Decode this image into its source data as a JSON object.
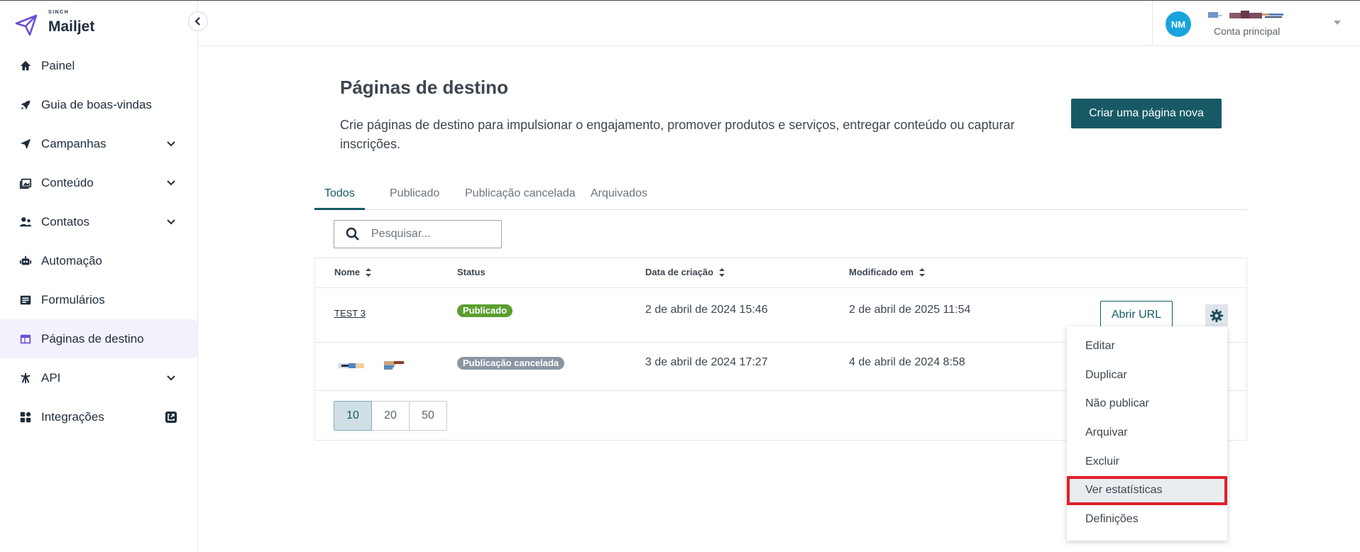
{
  "brand": {
    "sinch": "SINCH",
    "name": "Mailjet"
  },
  "sidebar": {
    "collapse_icon": "chevron-left-icon",
    "items": [
      {
        "label": "Painel",
        "icon": "home-icon"
      },
      {
        "label": "Guia de boas-vindas",
        "icon": "rocket-icon"
      },
      {
        "label": "Campanhas",
        "icon": "paper-plane-icon",
        "expandable": true
      },
      {
        "label": "Conteúdo",
        "icon": "image-gallery-icon",
        "expandable": true
      },
      {
        "label": "Contatos",
        "icon": "users-icon",
        "expandable": true
      },
      {
        "label": "Automação",
        "icon": "robot-icon"
      },
      {
        "label": "Formulários",
        "icon": "form-icon"
      },
      {
        "label": "Páginas de destino",
        "icon": "layout-icon",
        "active": true
      },
      {
        "label": "API",
        "icon": "api-icon",
        "expandable": true
      },
      {
        "label": "Integrações",
        "icon": "grid-icon",
        "external": true
      }
    ]
  },
  "header": {
    "avatar_initials": "NM",
    "account_type": "Conta principal"
  },
  "page": {
    "title": "Páginas de destino",
    "description": "Crie páginas de destino para impulsionar o engajamento, promover produtos e serviços, entregar conteúdo ou capturar inscrições.",
    "create_button": "Criar uma página nova"
  },
  "tabs": [
    {
      "label": "Todos",
      "active": true
    },
    {
      "label": "Publicado"
    },
    {
      "label": "Publicação cancelada"
    },
    {
      "label": "Arquivados"
    }
  ],
  "search": {
    "placeholder": "Pesquisar..."
  },
  "table": {
    "headers": {
      "name": "Nome",
      "status": "Status",
      "created": "Data de criação",
      "modified": "Modificado em"
    },
    "rows": [
      {
        "name": "TEST 3",
        "status": "Publicado",
        "created": "2 de abril de 2024 15:46",
        "modified": "2 de abril de 2025 11:54",
        "action": "Abrir URL"
      },
      {
        "name": "",
        "status": "Publicação cancelada",
        "created": "3 de abril de 2024 17:27",
        "modified": "4 de abril de 2024 8:58"
      }
    ]
  },
  "pagination": {
    "sizes": [
      "10",
      "20",
      "50"
    ],
    "selected": "10"
  },
  "menu": {
    "items": [
      "Editar",
      "Duplicar",
      "Não publicar",
      "Arquivar",
      "Excluir",
      "Ver estatísticas",
      "Definições"
    ],
    "highlighted": "Ver estatísticas"
  },
  "colors": {
    "primary": "#175a66",
    "accent_purple": "#6b4fd8",
    "published": "#5a9e2f",
    "unpublished": "#8a96a3",
    "highlight": "#e0202a"
  }
}
